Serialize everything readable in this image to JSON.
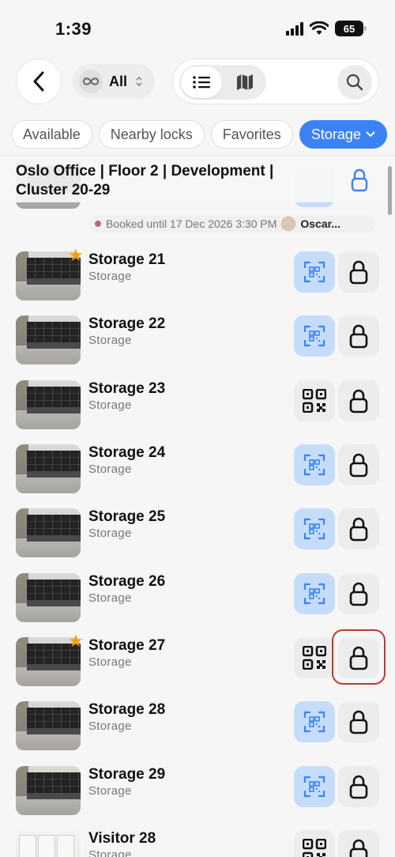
{
  "status_bar": {
    "time": "1:39",
    "battery": "65"
  },
  "toolbar": {
    "filter_label": "All"
  },
  "chips": [
    "Available",
    "Nearby locks",
    "Favorites",
    "Storage"
  ],
  "section": {
    "title": "Oslo Office | Floor 2 | Development | Cluster 20-29"
  },
  "booked": {
    "text": "Booked until 17 Dec 2026 3:30 PM",
    "user": "Oscar..."
  },
  "rows": [
    {
      "title": "Storage 21",
      "subtitle": "Storage",
      "favorite": true,
      "qr_style": "blue"
    },
    {
      "title": "Storage 22",
      "subtitle": "Storage",
      "favorite": false,
      "qr_style": "blue"
    },
    {
      "title": "Storage 23",
      "subtitle": "Storage",
      "favorite": false,
      "qr_style": "plain"
    },
    {
      "title": "Storage 24",
      "subtitle": "Storage",
      "favorite": false,
      "qr_style": "blue"
    },
    {
      "title": "Storage 25",
      "subtitle": "Storage",
      "favorite": false,
      "qr_style": "blue"
    },
    {
      "title": "Storage 26",
      "subtitle": "Storage",
      "favorite": false,
      "qr_style": "blue"
    },
    {
      "title": "Storage 27",
      "subtitle": "Storage",
      "favorite": true,
      "qr_style": "plain",
      "highlighted": true
    },
    {
      "title": "Storage 28",
      "subtitle": "Storage",
      "favorite": false,
      "qr_style": "blue"
    },
    {
      "title": "Storage 29",
      "subtitle": "Storage",
      "favorite": false,
      "qr_style": "blue"
    },
    {
      "title": "Visitor 28",
      "subtitle": "Storage",
      "favorite": false,
      "qr_style": "plain"
    }
  ],
  "colors": {
    "accent": "#3b82f6",
    "qr_blue_bg": "#c6dcfb",
    "favorite_star": "#f59e0b",
    "highlight": "#c0392b"
  }
}
